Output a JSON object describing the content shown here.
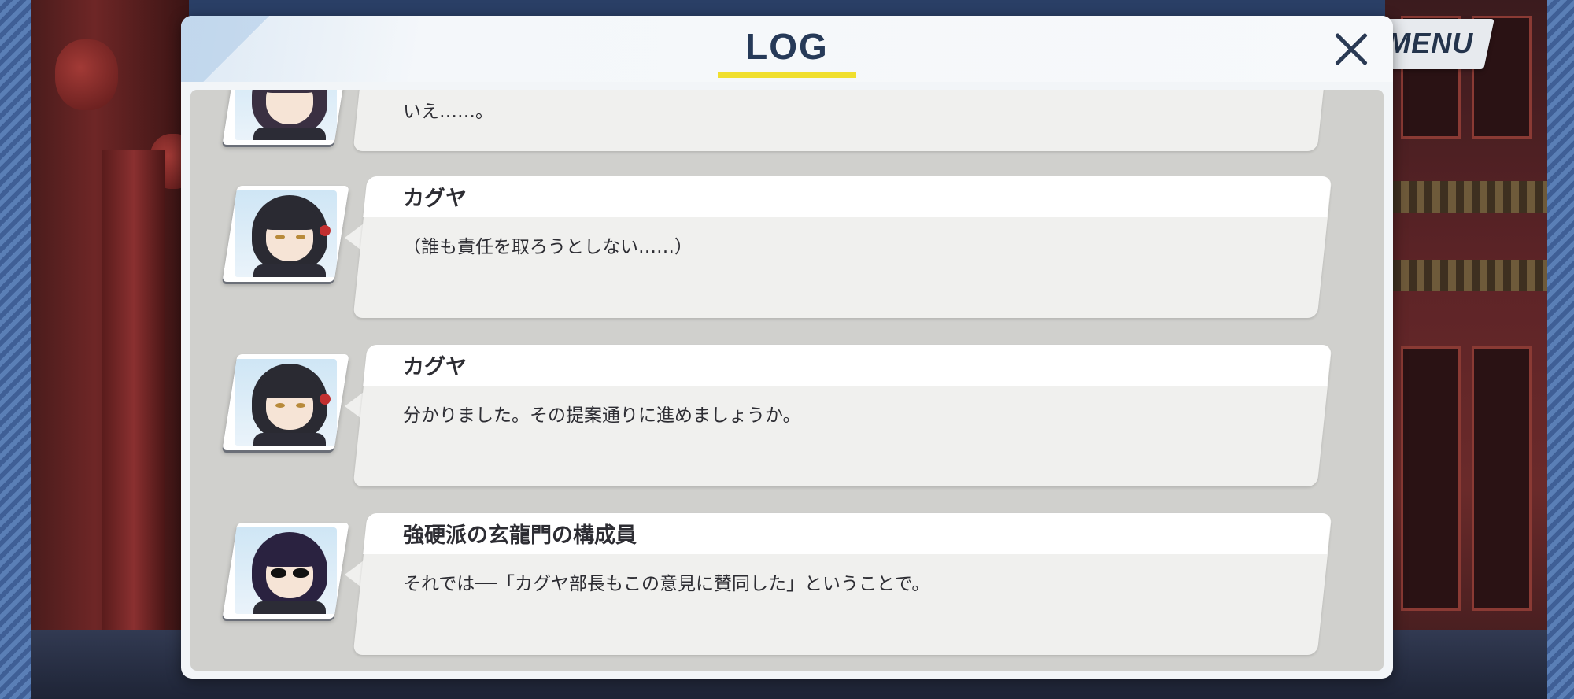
{
  "top_menu": {
    "label": "MENU"
  },
  "log_window": {
    "title": "LOG",
    "accent_color": "#f0df2e",
    "close_icon": "close-icon"
  },
  "entries": [
    {
      "speaker": "",
      "text": "いえ……。",
      "portrait": "student-with-headset"
    },
    {
      "speaker": "カグヤ",
      "text": "（誰も責任を取ろうとしない……）",
      "portrait": "kaguya"
    },
    {
      "speaker": "カグヤ",
      "text": "分かりました。その提案通りに進めましょうか。",
      "portrait": "kaguya"
    },
    {
      "speaker": "強硬派の玄龍門の構成員",
      "text": "それでは──「カグヤ部長もこの意見に賛同した」ということで。",
      "portrait": "member-with-sunglasses"
    }
  ]
}
